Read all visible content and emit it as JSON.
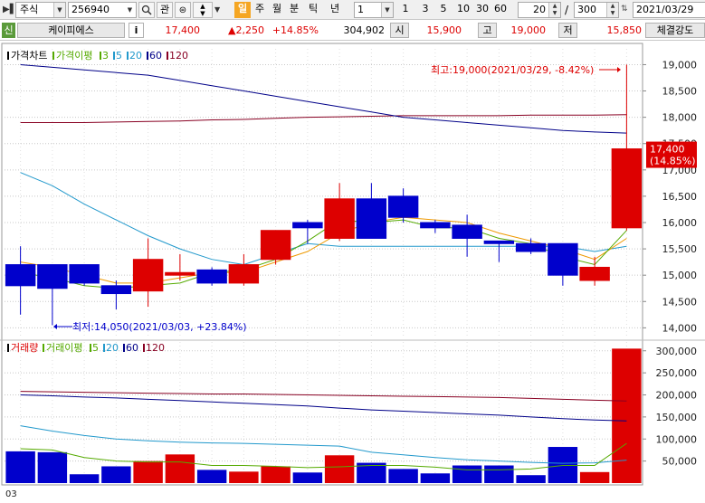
{
  "toolbar": {
    "market": "주식",
    "code": "256940",
    "search_icon": "search-icon",
    "interest_label": "관",
    "period_buttons": [
      "일",
      "주",
      "월",
      "분",
      "틱",
      "년"
    ],
    "active_period": "일",
    "interval_value": "1",
    "interval_buttons": [
      "1",
      "3",
      "5",
      "10",
      "30",
      "60"
    ],
    "count_value": "20",
    "slash": "/",
    "total_value": "300",
    "date_value": "2021/03/29"
  },
  "quote": {
    "badge": "신",
    "name": "케이피에스",
    "info_label": "i",
    "price": "17,400",
    "change": "▲2,250",
    "change_rate": "+14.85%",
    "volume": "304,902",
    "open_label": "시",
    "open": "15,900",
    "high_label": "고",
    "high": "19,000",
    "low_label": "저",
    "low": "15,850",
    "strength_label": "체결강도"
  },
  "colors": {
    "up": "#dd0000",
    "down": "#0000cc",
    "ma3": "#55aa00",
    "ma5": "#ee9900",
    "ma20": "#2299cc",
    "ma60": "#000088",
    "ma120": "#880022",
    "grid": "#c8c8c8"
  },
  "legend": {
    "price": {
      "title": "가격차트",
      "ma_label": "가격이평",
      "periods": [
        "3",
        "5",
        "20",
        "60",
        "120"
      ]
    },
    "volume": {
      "title": "거래량",
      "ma_label": "거래이평",
      "periods": [
        "5",
        "20",
        "60",
        "120"
      ]
    }
  },
  "annotations": {
    "high": "최고:19,000(2021/03/29, -8.42%)",
    "low": "최저:14,050(2021/03/03, +23.84%)",
    "current_price": "17,400",
    "current_rate": "(14.85%)",
    "x_start_label": "03"
  },
  "chart_data": [
    {
      "type": "candlestick",
      "title": "가격차트",
      "ylim": [
        13800,
        19300
      ],
      "yticks": [
        14000,
        14500,
        15000,
        15500,
        16000,
        16500,
        17000,
        17500,
        18000,
        18500,
        19000
      ],
      "ytick_labels": [
        "14,000",
        "14,500",
        "15,000",
        "15,500",
        "16,000",
        "16,500",
        "17,000",
        "17,500",
        "18,000",
        "18,500",
        "19,000"
      ],
      "candles": [
        {
          "o": 15200,
          "h": 15550,
          "l": 14250,
          "c": 14800
        },
        {
          "o": 15200,
          "h": 15200,
          "l": 14050,
          "c": 14750
        },
        {
          "o": 15200,
          "h": 15200,
          "l": 14800,
          "c": 14850
        },
        {
          "o": 14800,
          "h": 14900,
          "l": 14350,
          "c": 14650
        },
        {
          "o": 14700,
          "h": 15700,
          "l": 14400,
          "c": 15300
        },
        {
          "o": 15000,
          "h": 15400,
          "l": 14900,
          "c": 15050
        },
        {
          "o": 15100,
          "h": 15150,
          "l": 14800,
          "c": 14850
        },
        {
          "o": 14850,
          "h": 15400,
          "l": 14800,
          "c": 15200
        },
        {
          "o": 15300,
          "h": 15850,
          "l": 15200,
          "c": 15850
        },
        {
          "o": 16000,
          "h": 16050,
          "l": 15600,
          "c": 15900
        },
        {
          "o": 15700,
          "h": 16750,
          "l": 15650,
          "c": 16450
        },
        {
          "o": 16450,
          "h": 16750,
          "l": 15700,
          "c": 15700
        },
        {
          "o": 16500,
          "h": 16650,
          "l": 16000,
          "c": 16100
        },
        {
          "o": 16000,
          "h": 16050,
          "l": 15800,
          "c": 15900
        },
        {
          "o": 15950,
          "h": 16150,
          "l": 15350,
          "c": 15700
        },
        {
          "o": 15650,
          "h": 15650,
          "l": 15250,
          "c": 15600
        },
        {
          "o": 15600,
          "h": 15700,
          "l": 15400,
          "c": 15450
        },
        {
          "o": 15600,
          "h": 15600,
          "l": 14800,
          "c": 15000
        },
        {
          "o": 14900,
          "h": 15350,
          "l": 14800,
          "c": 15150
        },
        {
          "o": 15900,
          "h": 19000,
          "l": 15850,
          "c": 17400
        }
      ],
      "ma3": [
        15050,
        14950,
        14800,
        14750,
        14800,
        14850,
        15050,
        15100,
        15300,
        15650,
        16050,
        16000,
        16050,
        15900,
        15900,
        15700,
        15600,
        15350,
        15200,
        15850
      ],
      "ma5": [
        15250,
        15150,
        15000,
        14850,
        14850,
        14950,
        15050,
        15050,
        15250,
        15450,
        15800,
        16000,
        16100,
        16050,
        16000,
        15800,
        15650,
        15500,
        15300,
        15700
      ],
      "ma20": [
        16950,
        16700,
        16350,
        16050,
        15750,
        15500,
        15300,
        15200,
        15400,
        15600,
        15550,
        15550,
        15550,
        15550,
        15550,
        15550,
        15550,
        15550,
        15450,
        15550
      ],
      "ma60": [
        19000,
        18950,
        18900,
        18850,
        18800,
        18700,
        18600,
        18500,
        18400,
        18300,
        18200,
        18100,
        18000,
        17950,
        17900,
        17850,
        17800,
        17750,
        17720,
        17700
      ],
      "ma120": [
        17900,
        17900,
        17900,
        17910,
        17920,
        17930,
        17950,
        17960,
        17980,
        18000,
        18010,
        18020,
        18030,
        18030,
        18030,
        18030,
        18040,
        18040,
        18040,
        18050
      ]
    },
    {
      "type": "bar",
      "title": "거래량",
      "ylim": [
        0,
        320000
      ],
      "yticks": [
        50000,
        100000,
        150000,
        200000,
        250000,
        300000
      ],
      "ytick_labels": [
        "50,000",
        "100,000",
        "150,000",
        "200,000",
        "250,000",
        "300,000"
      ],
      "values": [
        72000,
        70000,
        20000,
        38000,
        50000,
        65000,
        30000,
        26000,
        38000,
        24000,
        63000,
        46000,
        32000,
        22000,
        40000,
        40000,
        18000,
        82000,
        25000,
        304902
      ],
      "ma5": [
        78000,
        75000,
        58000,
        50000,
        48000,
        48000,
        40000,
        40000,
        38000,
        35000,
        37000,
        40000,
        40000,
        36000,
        30000,
        30000,
        32000,
        40000,
        40000,
        90000
      ],
      "ma20": [
        130000,
        118000,
        108000,
        100000,
        96000,
        93000,
        91000,
        90000,
        88000,
        86000,
        84000,
        70000,
        64000,
        58000,
        53000,
        50000,
        47000,
        45000,
        46000,
        52000
      ],
      "ma60": [
        200000,
        198000,
        195000,
        193000,
        190000,
        187000,
        184000,
        181000,
        178000,
        175000,
        170000,
        166000,
        163000,
        160000,
        157000,
        154000,
        150000,
        146000,
        143000,
        141000
      ],
      "ma120": [
        208000,
        207000,
        206000,
        205000,
        204000,
        203000,
        202000,
        202000,
        201000,
        200000,
        199000,
        198000,
        197000,
        196000,
        195000,
        194000,
        192000,
        190000,
        188000,
        186000
      ]
    }
  ]
}
